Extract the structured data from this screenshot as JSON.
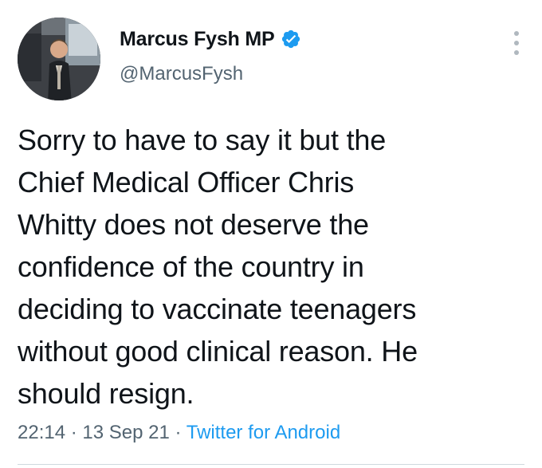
{
  "author": {
    "display_name": "Marcus Fysh MP",
    "handle": "@MarcusFysh",
    "verified": true,
    "avatar_icon": "profile-photo-man-in-suit"
  },
  "tweet": {
    "text": "Sorry to have to say it but the Chief Medical Officer Chris Whitty does not deserve the confidence of the country in deciding to vaccinate teenagers without good clinical reason. He should resign.",
    "lines": [
      "Sorry to have to say it but the",
      "Chief Medical Officer Chris",
      "Whitty does not deserve the",
      "confidence of the country in",
      "deciding to vaccinate teenagers",
      "without good clinical reason. He",
      "should resign."
    ],
    "time": "22:14",
    "separator": "·",
    "date": "13 Sep 21",
    "source": "Twitter for Android"
  },
  "colors": {
    "text": "#0f1419",
    "secondary": "#536471",
    "link": "#1d9bf0",
    "verified": "#1d9bf0",
    "divider": "#cfd9de"
  }
}
